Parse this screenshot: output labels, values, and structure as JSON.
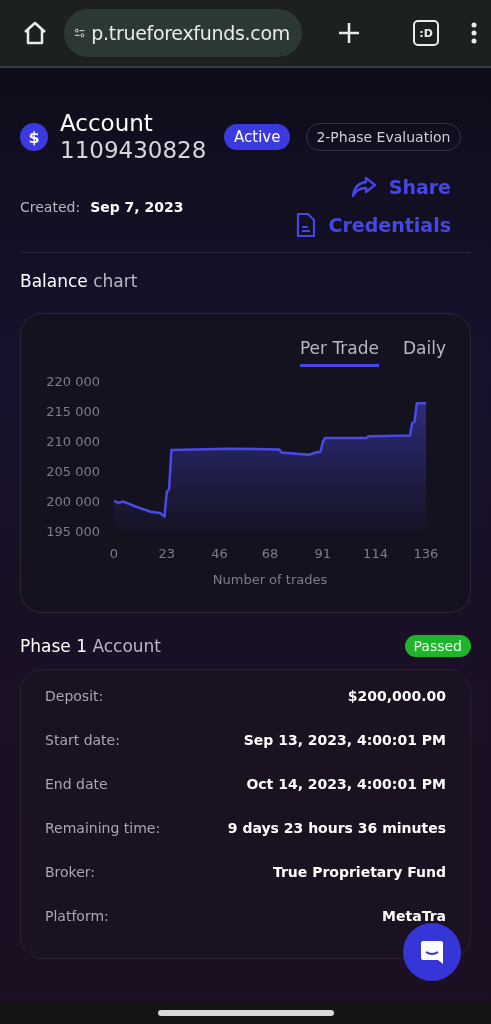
{
  "browser": {
    "url": "p.trueforexfunds.com",
    "tab_count": ":D"
  },
  "account": {
    "currency_symbol": "$",
    "title": "Account",
    "number": "1109430828",
    "status": {
      "label": "Active",
      "kind": "active"
    },
    "type": "2-Phase Evaluation",
    "created_label": "Created:",
    "created_date": "Sep 7, 2023",
    "actions": [
      {
        "label": "Share",
        "kind": "share"
      },
      {
        "label": "Credentials",
        "kind": "document"
      }
    ]
  },
  "balance": {
    "title": "**Balance** chart",
    "tabs": [
      {
        "label": "Per Trade",
        "selected": true
      },
      {
        "label": "Daily",
        "selected": false
      }
    ],
    "chart_data": {
      "type": "area",
      "xlabel": "Number of trades",
      "x": [
        0,
        2,
        4,
        10,
        16,
        20,
        22,
        23,
        24,
        25,
        50,
        72,
        73,
        85,
        88,
        90,
        91,
        92,
        110,
        111,
        129,
        130,
        131,
        132,
        136
      ],
      "series": [
        {
          "color": "#4a4ae8",
          "values": [
            200000,
            199700,
            199900,
            199000,
            198200,
            198000,
            197400,
            201500,
            202000,
            208500,
            208700,
            208600,
            208100,
            207700,
            208100,
            208200,
            209800,
            210500,
            210500,
            210800,
            210900,
            213000,
            213200,
            216300,
            216300
          ]
        }
      ],
      "xlim": [
        0,
        136
      ],
      "ylim": [
        195000,
        220000
      ],
      "xticks": [
        0,
        23,
        46,
        68,
        91,
        114,
        136
      ],
      "yticks": [
        {
          "value": 195000,
          "label": "195 000"
        },
        {
          "value": 200000,
          "label": "200 000"
        },
        {
          "value": 205000,
          "label": "205 000"
        },
        {
          "value": 210000,
          "label": "210 000"
        },
        {
          "value": 215000,
          "label": "215 000"
        },
        {
          "value": 220000,
          "label": "220 000"
        }
      ]
    }
  },
  "phase": {
    "title": "**Phase 1** Account",
    "status": {
      "label": "Passed",
      "kind": "passed"
    },
    "rows": [
      {
        "label": "Deposit:",
        "value": "$200,000.00"
      },
      {
        "label": "Start date:",
        "value": "Sep 13, 2023, 4:00:01 PM"
      },
      {
        "label": "End date",
        "value": "Oct 14, 2023, 4:00:01 PM"
      },
      {
        "label": "Remaining time:",
        "value": "9 days 23 hours 36 minutes"
      },
      {
        "label": "Broker:",
        "value": "True Proprietary Fund"
      },
      {
        "label": "Platform:",
        "value": "MetaTra"
      }
    ]
  }
}
